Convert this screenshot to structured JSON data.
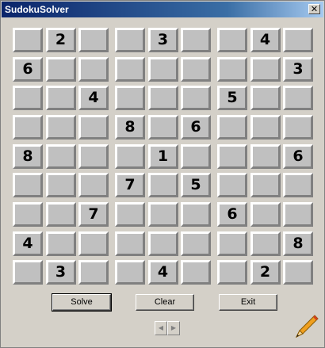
{
  "window": {
    "title": "SudokuSolver",
    "close_glyph": "✕"
  },
  "grid": [
    [
      "",
      "2",
      "",
      "",
      "3",
      "",
      "",
      "4",
      ""
    ],
    [
      "6",
      "",
      "",
      "",
      "",
      "",
      "",
      "",
      "3"
    ],
    [
      "",
      "",
      "4",
      "",
      "",
      "",
      "5",
      "",
      ""
    ],
    [
      "",
      "",
      "",
      "8",
      "",
      "6",
      "",
      "",
      ""
    ],
    [
      "8",
      "",
      "",
      "",
      "1",
      "",
      "",
      "",
      "6"
    ],
    [
      "",
      "",
      "",
      "7",
      "",
      "5",
      "",
      "",
      ""
    ],
    [
      "",
      "",
      "7",
      "",
      "",
      "",
      "6",
      "",
      ""
    ],
    [
      "4",
      "",
      "",
      "",
      "",
      "",
      "",
      "",
      "8"
    ],
    [
      "",
      "3",
      "",
      "",
      "4",
      "",
      "",
      "2",
      ""
    ]
  ],
  "buttons": {
    "solve": "Solve",
    "clear": "Clear",
    "exit": "Exit"
  },
  "spinner": {
    "left_glyph": "◀",
    "right_glyph": "▶"
  },
  "icons": {
    "corner_icon": "pencil-icon"
  }
}
